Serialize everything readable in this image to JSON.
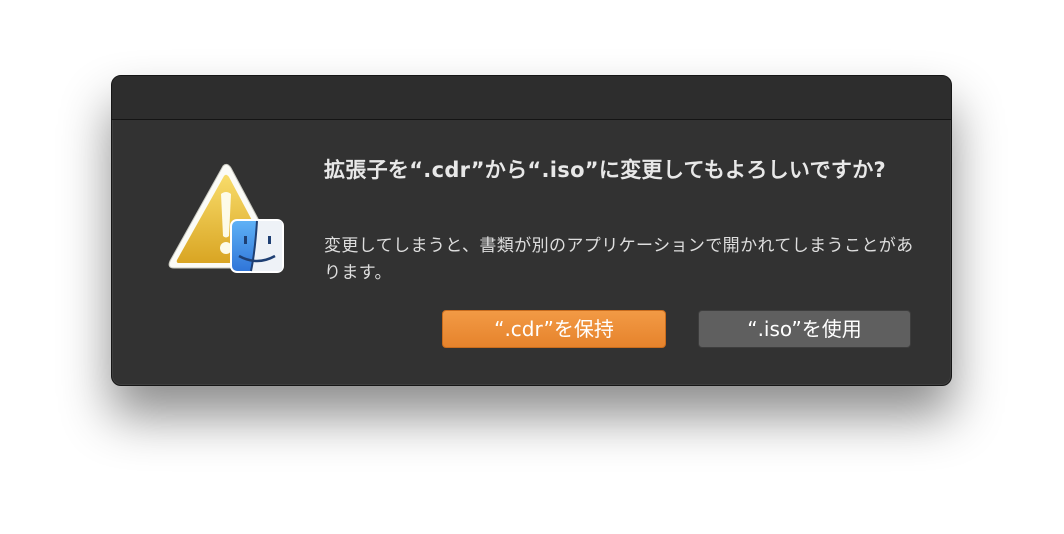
{
  "dialog": {
    "title": "拡張子を“.cdr”から“.iso”に変更してもよろしいですか?",
    "message": "変更してしまうと、書類が別のアプリケーションで開かれてしまうことがあります。",
    "icon": "warning-finder-icon",
    "buttons": {
      "keep_label": "“.cdr”を保持",
      "use_label": "“.iso”を使用"
    }
  },
  "colors": {
    "dialog_bg": "#323232",
    "primary_button": "#ee8f3a",
    "secondary_button": "#5f5f5f",
    "warning_yellow": "#e9b73a",
    "finder_blue": "#3f8ee6"
  }
}
